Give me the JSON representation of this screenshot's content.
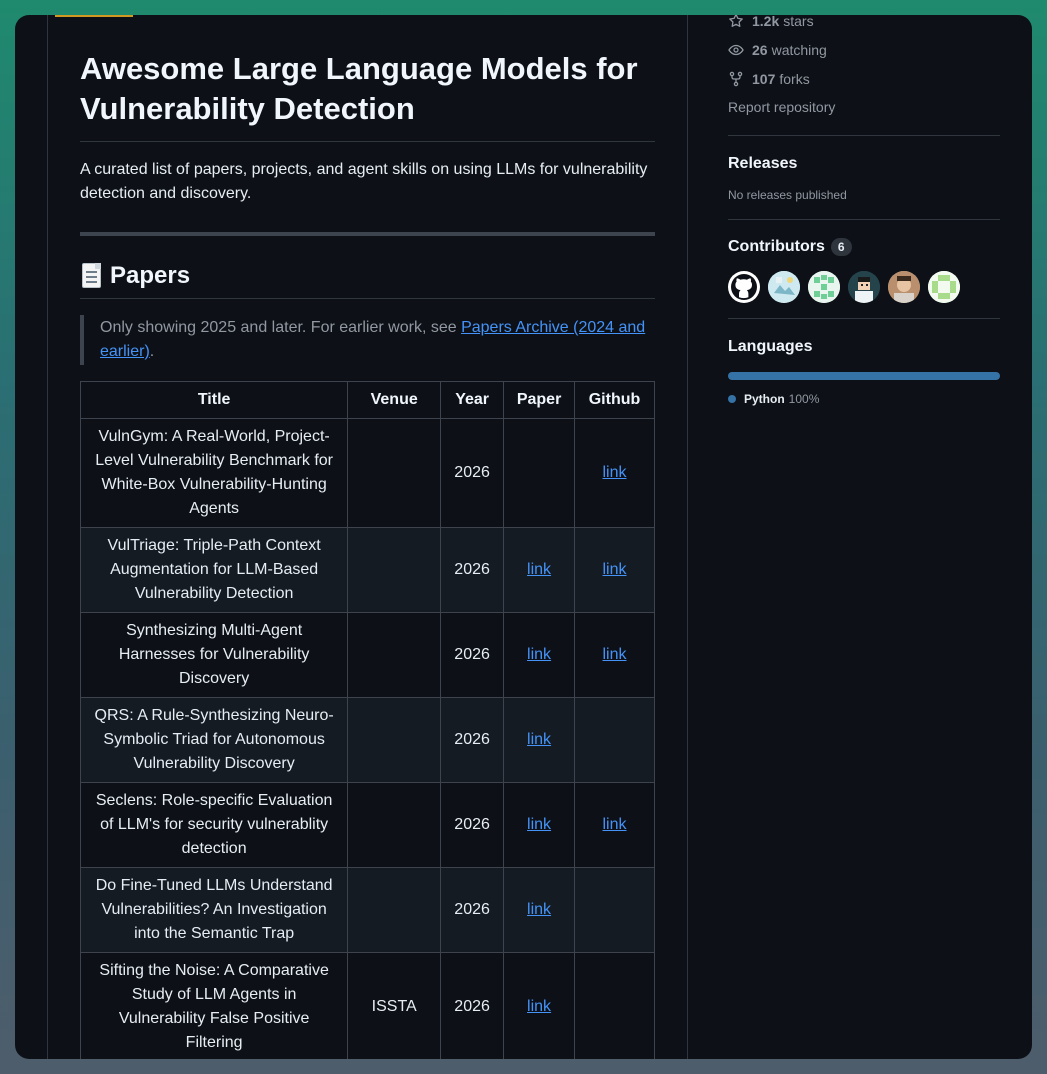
{
  "readme": {
    "title": "Awesome Large Language Models for Vulnerability Detection",
    "description": "A curated list of papers, projects, and agent skills on using LLMs for vulnerability detection and discovery.",
    "papers_heading": "Papers",
    "note_prefix": "Only showing 2025 and later. For earlier work, see ",
    "note_link": "Papers Archive (2024 and earlier)",
    "note_suffix": ".",
    "table": {
      "headers": [
        "Title",
        "Venue",
        "Year",
        "Paper",
        "Github"
      ],
      "rows": [
        {
          "title": "VulnGym: A Real-World, Project-Level Vulnerability Benchmark for White-Box Vulnerability-Hunting Agents",
          "venue": "",
          "year": "2026",
          "paper": "",
          "github": "link"
        },
        {
          "title": "VulTriage: Triple-Path Context Augmentation for LLM-Based Vulnerability Detection",
          "venue": "",
          "year": "2026",
          "paper": "link",
          "github": "link"
        },
        {
          "title": "Synthesizing Multi-Agent Harnesses for Vulnerability Discovery",
          "venue": "",
          "year": "2026",
          "paper": "link",
          "github": "link"
        },
        {
          "title": "QRS: A Rule-Synthesizing Neuro-Symbolic Triad for Autonomous Vulnerability Discovery",
          "venue": "",
          "year": "2026",
          "paper": "link",
          "github": ""
        },
        {
          "title": "Seclens: Role-specific Evaluation of LLM's for security vulnerablity detection",
          "venue": "",
          "year": "2026",
          "paper": "link",
          "github": "link"
        },
        {
          "title": "Do Fine-Tuned LLMs Understand Vulnerabilities? An Investigation into the Semantic Trap",
          "venue": "",
          "year": "2026",
          "paper": "link",
          "github": ""
        },
        {
          "title": "Sifting the Noise: A Comparative Study of LLM Agents in Vulnerability False Positive Filtering",
          "venue": "ISSTA",
          "year": "2026",
          "paper": "link",
          "github": ""
        }
      ]
    }
  },
  "sidebar": {
    "stars_count": "1.2k",
    "stars_label": "stars",
    "watching_count": "26",
    "watching_label": "watching",
    "forks_count": "107",
    "forks_label": "forks",
    "report": "Report repository",
    "releases_heading": "Releases",
    "releases_note": "No releases published",
    "contributors_heading": "Contributors",
    "contributors_count": "6",
    "languages_heading": "Languages",
    "language_name": "Python",
    "language_percent": "100%",
    "language_color": "#3572a5"
  }
}
